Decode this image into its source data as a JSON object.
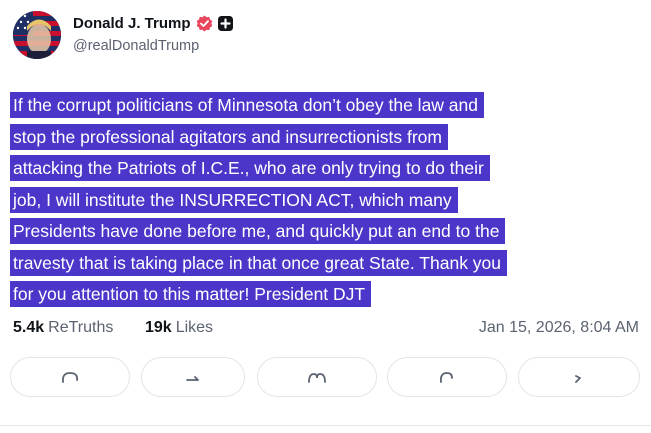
{
  "author": {
    "display_name": "Donald J. Trump",
    "handle": "@realDonaldTrump"
  },
  "post": {
    "lines": [
      "If the corrupt politicians of Minnesota don’t obey the law and",
      "stop the professional agitators and insurrectionists from",
      "attacking the Patriots of I.C.E., who are only trying to do their",
      "job, I will institute the INSURRECTION ACT, which many",
      "Presidents have done before me, and quickly put an end to the",
      "travesty that is taking place in that once great State. Thank you",
      "for you attention to this matter! President DJT"
    ],
    "selection_color": "#4a37c9"
  },
  "stats": {
    "retruths_count": "5.4k",
    "retruths_label": "ReTruths",
    "likes_count": "19k",
    "likes_label": "Likes",
    "timestamp": "Jan 15, 2026, 8:04 AM"
  },
  "actions": [
    {
      "icon": "reply-icon"
    },
    {
      "icon": "retruth-icon"
    },
    {
      "icon": "like-icon"
    },
    {
      "icon": "quote-icon"
    },
    {
      "icon": "share-icon"
    }
  ],
  "colors": {
    "verified": "#e8465c",
    "text": "#0f1419",
    "muted": "#5b6270"
  }
}
